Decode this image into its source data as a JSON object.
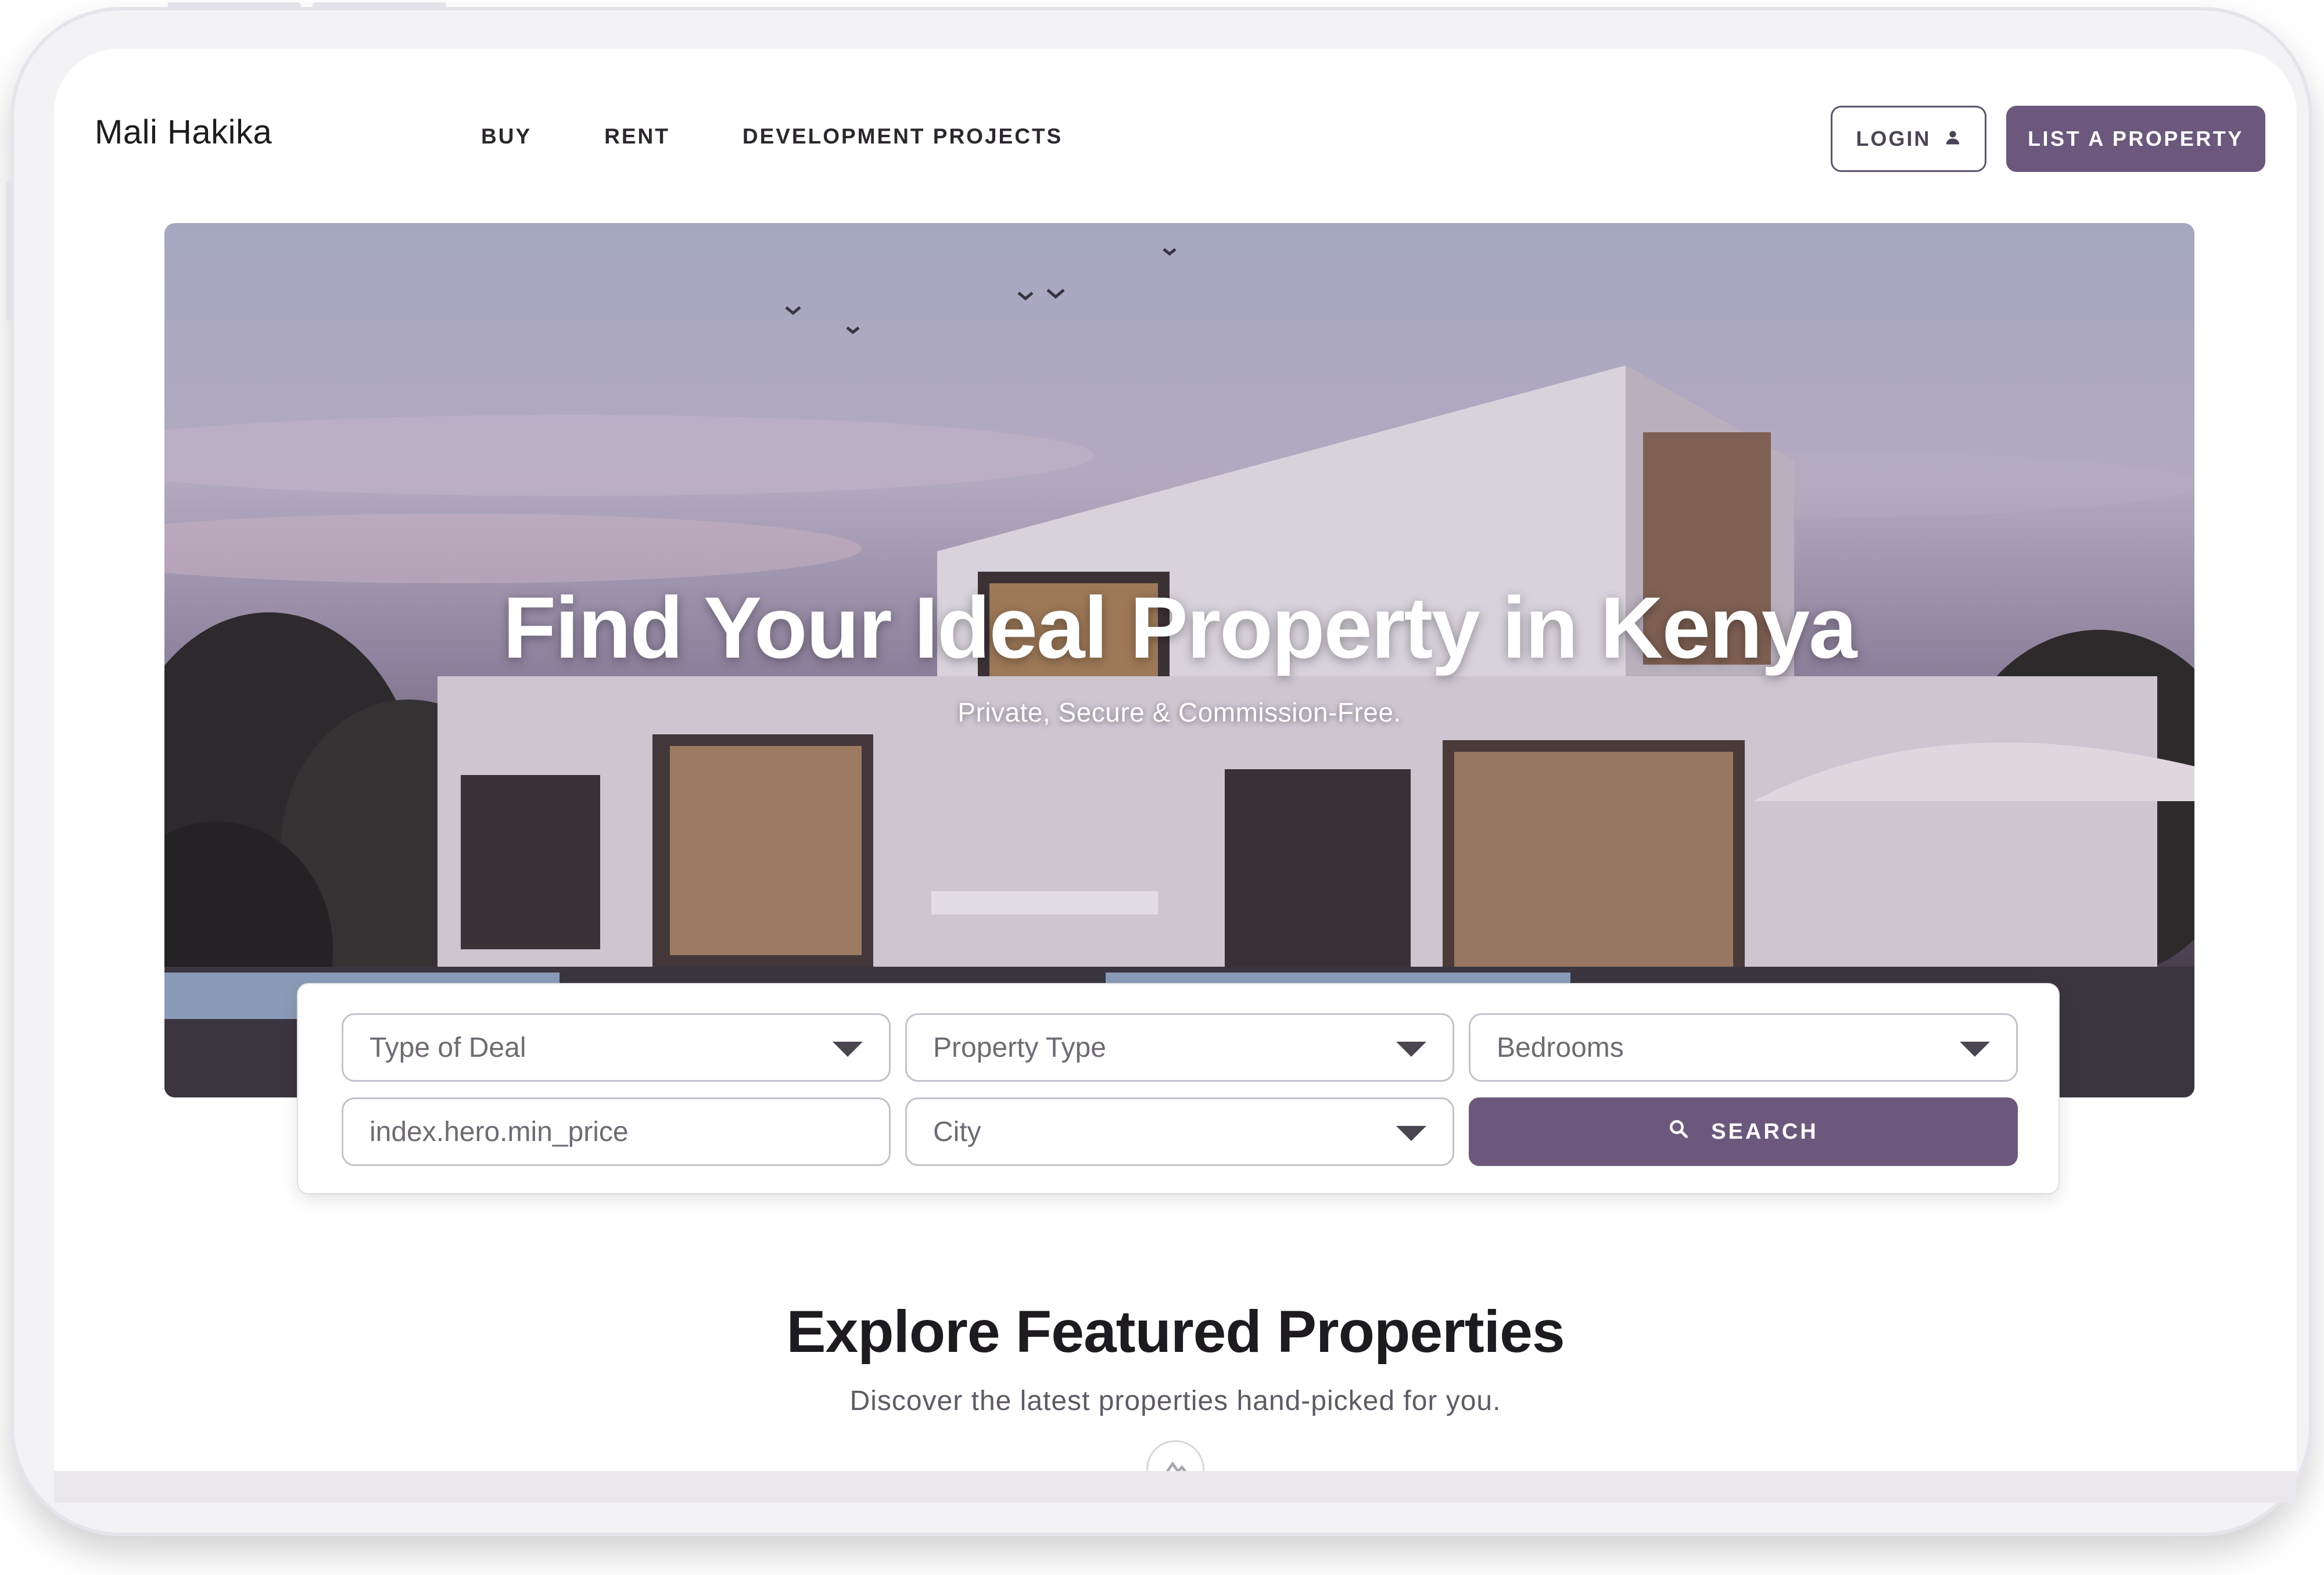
{
  "brand": "Mali Hakika",
  "nav": {
    "items": [
      "BUY",
      "RENT",
      "DEVELOPMENT PROJECTS"
    ],
    "login_label": "LOGIN",
    "list_label": "LIST A PROPERTY"
  },
  "hero": {
    "title": "Find Your Ideal Property in Kenya",
    "subtitle": "Private, Secure & Commission-Free."
  },
  "search": {
    "deal_type": "Type of Deal",
    "property_type": "Property Type",
    "bedrooms": "Bedrooms",
    "min_price_placeholder": "index.hero.min_price",
    "city": "City",
    "search_label": "SEARCH"
  },
  "featured": {
    "title": "Explore Featured Properties",
    "subtitle": "Discover the latest properties hand-picked for you."
  },
  "colors": {
    "accent": "#6b587c",
    "text": "#1d1b20"
  }
}
